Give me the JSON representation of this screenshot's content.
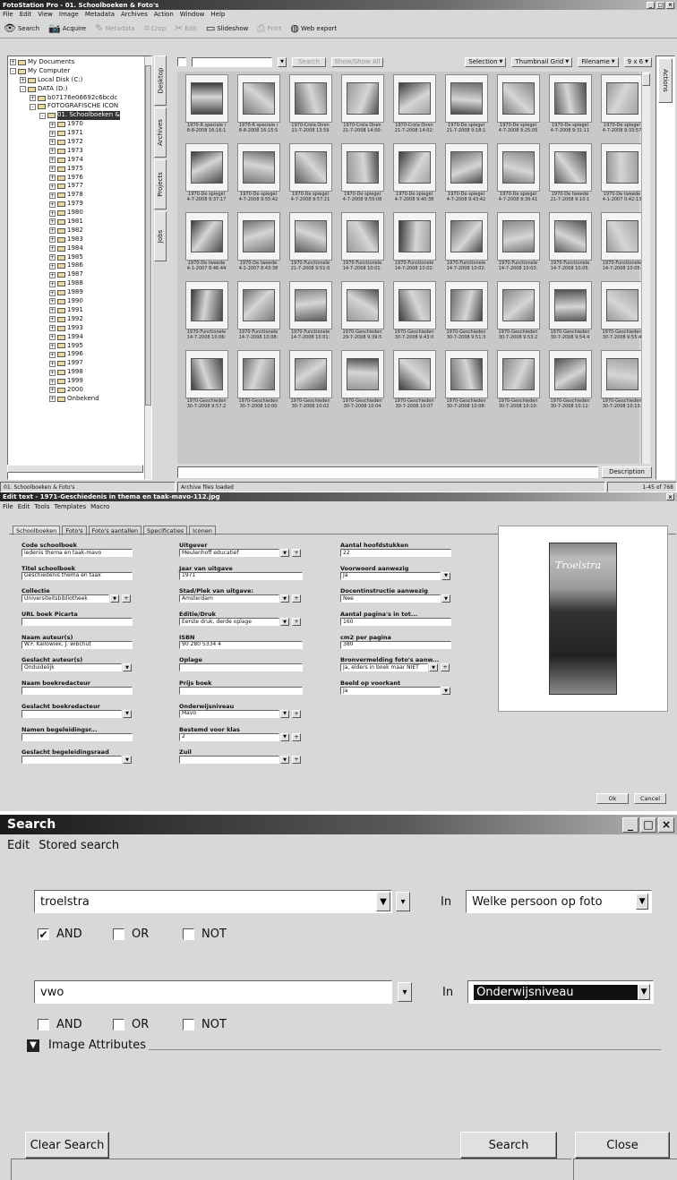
{
  "fotostation": {
    "title": "FotoStation Pro - 01. Schoolboeken & Foto's",
    "menu": [
      "File",
      "Edit",
      "View",
      "Image",
      "Metadata",
      "Archives",
      "Action",
      "Window",
      "Help"
    ],
    "toolbar": [
      {
        "label": "Search",
        "icon": "eye-icon",
        "enabled": true
      },
      {
        "label": "Acquire",
        "icon": "camera-icon",
        "enabled": true
      },
      {
        "label": "Metadata",
        "icon": "pencil-icon",
        "enabled": false
      },
      {
        "label": "Crop",
        "icon": "crop-icon",
        "enabled": false
      },
      {
        "label": "Edit",
        "icon": "edit-icon",
        "enabled": false
      },
      {
        "label": "Slideshow",
        "icon": "slideshow-icon",
        "enabled": true
      },
      {
        "label": "Print",
        "icon": "printer-icon",
        "enabled": false
      },
      {
        "label": "Web export",
        "icon": "globe-icon",
        "enabled": true
      }
    ],
    "tree": [
      {
        "label": "My Documents",
        "level": 0,
        "sign": "+"
      },
      {
        "label": "My Computer",
        "level": 0,
        "sign": "-"
      },
      {
        "label": "Local Disk (C:)",
        "level": 1,
        "sign": "+"
      },
      {
        "label": "DATA (D:)",
        "level": 1,
        "sign": "-"
      },
      {
        "label": "b07176e06692c6bcdc",
        "level": 2,
        "sign": "+"
      },
      {
        "label": "FOTOGRAFISCHE ICON",
        "level": 2,
        "sign": "-"
      },
      {
        "label": "01. Schoolboeken &",
        "level": 3,
        "sign": "-",
        "selected": true
      },
      {
        "label": "1970",
        "level": 4,
        "sign": "+"
      },
      {
        "label": "1971",
        "level": 4,
        "sign": "+"
      },
      {
        "label": "1972",
        "level": 4,
        "sign": "+"
      },
      {
        "label": "1973",
        "level": 4,
        "sign": "+"
      },
      {
        "label": "1974",
        "level": 4,
        "sign": "+"
      },
      {
        "label": "1975",
        "level": 4,
        "sign": "+"
      },
      {
        "label": "1976",
        "level": 4,
        "sign": "+"
      },
      {
        "label": "1977",
        "level": 4,
        "sign": "+"
      },
      {
        "label": "1978",
        "level": 4,
        "sign": "+"
      },
      {
        "label": "1979",
        "level": 4,
        "sign": "+"
      },
      {
        "label": "1980",
        "level": 4,
        "sign": "+"
      },
      {
        "label": "1981",
        "level": 4,
        "sign": "+"
      },
      {
        "label": "1982",
        "level": 4,
        "sign": "+"
      },
      {
        "label": "1983",
        "level": 4,
        "sign": "+"
      },
      {
        "label": "1984",
        "level": 4,
        "sign": "+"
      },
      {
        "label": "1985",
        "level": 4,
        "sign": "+"
      },
      {
        "label": "1986",
        "level": 4,
        "sign": "+"
      },
      {
        "label": "1987",
        "level": 4,
        "sign": "+"
      },
      {
        "label": "1988",
        "level": 4,
        "sign": "+"
      },
      {
        "label": "1989",
        "level": 4,
        "sign": "+"
      },
      {
        "label": "1990",
        "level": 4,
        "sign": "+"
      },
      {
        "label": "1991",
        "level": 4,
        "sign": "+"
      },
      {
        "label": "1992",
        "level": 4,
        "sign": "+"
      },
      {
        "label": "1993",
        "level": 4,
        "sign": "+"
      },
      {
        "label": "1994",
        "level": 4,
        "sign": "+"
      },
      {
        "label": "1995",
        "level": 4,
        "sign": "+"
      },
      {
        "label": "1996",
        "level": 4,
        "sign": "+"
      },
      {
        "label": "1997",
        "level": 4,
        "sign": "+"
      },
      {
        "label": "1998",
        "level": 4,
        "sign": "+"
      },
      {
        "label": "1999",
        "level": 4,
        "sign": "+"
      },
      {
        "label": "2000",
        "level": 4,
        "sign": "+"
      },
      {
        "label": "Onbekend",
        "level": 4,
        "sign": "+"
      }
    ],
    "side_tabs": [
      "Desktop",
      "Archives",
      "Projects",
      "Jobs"
    ],
    "right_tab": "Actions",
    "search_button": "Search",
    "show_all_button": "Show/Show All",
    "view_controls": [
      "Selection",
      "Thumbnail Grid",
      "Filename",
      "9 x 6"
    ],
    "thumbnails": [
      {
        "line1": "1970-R speciale i",
        "line2": "8-8-2008 16:16:1"
      },
      {
        "line1": "1970-R speciale i",
        "line2": "8-8-2008 16:15:5"
      },
      {
        "line1": "1970-Crola Onen",
        "line2": "21-7-2008 13:59"
      },
      {
        "line1": "1970-Crola Onen",
        "line2": "21-7-2008 14:00:"
      },
      {
        "line1": "1970-Crola Onen",
        "line2": "21-7-2008 14:02:"
      },
      {
        "line1": "1970-De spiegel",
        "line2": "21-7-2008 9:18:1"
      },
      {
        "line1": "1970-De spiegel",
        "line2": "4-7-2008 9:25:05"
      },
      {
        "line1": "1970-De spiegel",
        "line2": "4-7-2008 9:31:11"
      },
      {
        "line1": "1970-De spiegel",
        "line2": "4-7-2008 9:33:57"
      },
      {
        "line1": "1970-De spiegel",
        "line2": "4-7-2008 9:37:17"
      },
      {
        "line1": "1970-De spiegel",
        "line2": "4-7-2008 9:55:42"
      },
      {
        "line1": "1970-De spiegel",
        "line2": "4-7-2008 9:57:21"
      },
      {
        "line1": "1970-De spiegel",
        "line2": "4-7-2008 9:59:08"
      },
      {
        "line1": "1970-De spiegel",
        "line2": "4-7-2008 9:40:38"
      },
      {
        "line1": "1970-De spiegel",
        "line2": "4-7-2008 9:43:42"
      },
      {
        "line1": "1970-De spiegel",
        "line2": "4-7-2008 9:39:41"
      },
      {
        "line1": "1970-De tweede",
        "line2": "21-7-2008 9:10:1"
      },
      {
        "line1": "1970-De tweede",
        "line2": "4-1-2007 0:42:13"
      },
      {
        "line1": "1970-De tweede",
        "line2": "4-1-2007 8:46:44"
      },
      {
        "line1": "1970-De tweede",
        "line2": "4-1-2007 8:43:38"
      },
      {
        "line1": "1970-Functionele",
        "line2": "21-7-2008 9:51:0"
      },
      {
        "line1": "1970-Functionele",
        "line2": "14-7-2008 10:01:"
      },
      {
        "line1": "1970-Functionele",
        "line2": "14-7-2008 10:02:"
      },
      {
        "line1": "1970-Functionele",
        "line2": "14-7-2008 10:02:"
      },
      {
        "line1": "1970-Functionele",
        "line2": "14-7-2008 10:03:"
      },
      {
        "line1": "1970-Functionele",
        "line2": "14-7-2008 10:05:"
      },
      {
        "line1": "1970-Functionele",
        "line2": "14-7-2008 10:05:"
      },
      {
        "line1": "1970-Functionele",
        "line2": "14-7-2008 10:06:"
      },
      {
        "line1": "1970-Functionele",
        "line2": "14-7-2008 10:08:"
      },
      {
        "line1": "1970-Functionele",
        "line2": "14-7-2008 10:01:"
      },
      {
        "line1": "1970-Geschieden",
        "line2": "29-7-2008 9:39:5"
      },
      {
        "line1": "1970-Geschieden",
        "line2": "30-7-2008 9:43:0"
      },
      {
        "line1": "1970-Geschieden",
        "line2": "30-7-2008 9:51:3"
      },
      {
        "line1": "1970-Geschieden",
        "line2": "30-7-2008 9:53:2"
      },
      {
        "line1": "1970-Geschieden",
        "line2": "30-7-2008 9:54:4"
      },
      {
        "line1": "1970-Geschieden",
        "line2": "30-7-2008 9:55:4"
      },
      {
        "line1": "1970-Geschieden",
        "line2": "30-7-2008 9:57:2"
      },
      {
        "line1": "1970-Geschieden",
        "line2": "30-7-2008 10:00"
      },
      {
        "line1": "1970-Geschieden",
        "line2": "30-7-2008 10:02"
      },
      {
        "line1": "1970-Geschieden",
        "line2": "30-7-2008 10:04"
      },
      {
        "line1": "1970-Geschieden",
        "line2": "30-7-2008 10:07"
      },
      {
        "line1": "1970-Geschieden",
        "line2": "30-7-2008 10:08:"
      },
      {
        "line1": "1970-Geschieden",
        "line2": "30-7-2008 10:10:"
      },
      {
        "line1": "1970-Geschieden",
        "line2": "30-7-2008 10:11:"
      },
      {
        "line1": "1970-Geschieden",
        "line2": "30-7-2008 10:13:"
      }
    ],
    "description_button": "Description",
    "status": [
      "01. Schoolboeken & Foto's",
      "Archive files loaded",
      "1-45 of 768"
    ]
  },
  "edit_text": {
    "title": "Edit text - 1971-Geschiedenis in thema en taak-mavo-112.jpg",
    "menu": [
      "File",
      "Edit",
      "Tools",
      "Templates",
      "Macro"
    ],
    "tabs": [
      "Schoolboeken",
      "Foto's",
      "Foto's aantallen",
      "Specificaties",
      "Iconen"
    ],
    "col1": [
      {
        "label": "Code schoolboek",
        "value": "iedenis thema en taak-mavo",
        "type": "text"
      },
      {
        "label": "Titel schoolboek",
        "value": "Geschiedenis thema en taak",
        "type": "text"
      },
      {
        "label": "Collectie",
        "value": "Universiteitsbibliotheek",
        "type": "select-plus"
      },
      {
        "label": "URL boek Picarta",
        "value": "",
        "type": "text"
      },
      {
        "label": "Naam auteur(s)",
        "value": "W.F. Kallowiek, J. wibchut",
        "type": "text"
      },
      {
        "label": "Geslacht auteur(s)",
        "value": "Onduidelijk",
        "type": "select"
      },
      {
        "label": "Naam boekredacteur",
        "value": "",
        "type": "text"
      },
      {
        "label": "Geslacht boekredacteur",
        "value": "",
        "type": "select"
      },
      {
        "label": "Namen begeleidingsr...",
        "value": "",
        "type": "text"
      },
      {
        "label": "Geslacht begeleidingsraad",
        "value": "",
        "type": "select"
      }
    ],
    "col2": [
      {
        "label": "Uitgever",
        "value": "Meulenhoff educatief",
        "type": "select-plus"
      },
      {
        "label": "Jaar van uitgave",
        "value": "1971",
        "type": "text"
      },
      {
        "label": "Stad/Plek van uitgave:",
        "value": "Amsterdam",
        "type": "select-plus"
      },
      {
        "label": "Editie/Druk",
        "value": "Eerste druk, derde oplage",
        "type": "select-plus"
      },
      {
        "label": "ISBN",
        "value": "90 280 5334 4",
        "type": "text"
      },
      {
        "label": "Oplage",
        "value": "",
        "type": "text"
      },
      {
        "label": "Prijs boek",
        "value": "",
        "type": "text"
      },
      {
        "label": "Onderwijsniveau",
        "value": "Mavo",
        "type": "select-plus"
      },
      {
        "label": "Bestemd voor klas",
        "value": "2",
        "type": "select-plus"
      },
      {
        "label": "Zuil",
        "value": "",
        "type": "select-plus"
      }
    ],
    "col3": [
      {
        "label": "Aantal hoofdstukken",
        "value": "22",
        "type": "text"
      },
      {
        "label": "Voorwoord aanwezig",
        "value": "Ja",
        "type": "select"
      },
      {
        "label": "Docentinstructie aanwezig",
        "value": "Nee",
        "type": "select"
      },
      {
        "label": "Aantal pagina's in tot...",
        "value": "160",
        "type": "text"
      },
      {
        "label": "cm2 per pagina",
        "value": "380",
        "type": "text"
      },
      {
        "label": "Bronvermelding foto's aanw...",
        "value": "Ja, elders in boek maar NIET",
        "type": "select-plus"
      },
      {
        "label": "Beeld op voorkant",
        "value": "Ja",
        "type": "select"
      }
    ],
    "cover_title": "Troelstra",
    "ok_button": "Ok",
    "cancel_button": "Cancel"
  },
  "search": {
    "title": "Search",
    "menu": [
      "Edit",
      "Stored search"
    ],
    "criterion1": {
      "value": "troelstra",
      "in_label": "In",
      "field": "Welke persoon op foto"
    },
    "ops1": [
      {
        "label": "AND",
        "checked": true
      },
      {
        "label": "OR",
        "checked": false
      },
      {
        "label": "NOT",
        "checked": false
      }
    ],
    "criterion2": {
      "value": "vwo",
      "in_label": "In",
      "field": "Onderwijsniveau"
    },
    "ops2": [
      {
        "label": "AND",
        "checked": false
      },
      {
        "label": "OR",
        "checked": false
      },
      {
        "label": "NOT",
        "checked": false
      }
    ],
    "image_attributes": "Image Attributes",
    "clear_button": "Clear Search",
    "search_button": "Search",
    "close_button": "Close"
  }
}
